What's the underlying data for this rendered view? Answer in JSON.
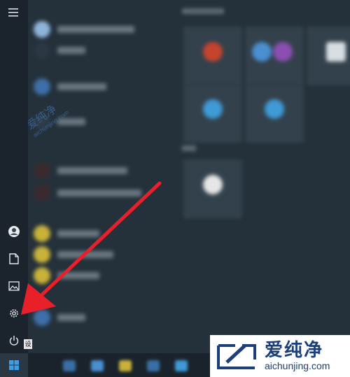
{
  "left_rail": {
    "menu_icon": "hamburger-menu-icon",
    "items": [
      {
        "name": "user-account",
        "icon": "user-avatar-icon"
      },
      {
        "name": "documents",
        "icon": "document-icon"
      },
      {
        "name": "pictures",
        "icon": "picture-icon"
      },
      {
        "name": "settings",
        "icon": "gear-icon"
      },
      {
        "name": "power",
        "icon": "power-icon"
      },
      {
        "name": "start",
        "icon": "windows-logo-icon"
      }
    ],
    "tooltip_partial": "设"
  },
  "annotation": {
    "arrow_color": "#e8202a",
    "arrow_points_to": "settings"
  },
  "watermark": {
    "chinese": "爱纯净",
    "url": "aichunjing.com",
    "color": "#1c3f7a"
  },
  "center_watermark": {
    "chinese": "爱纯净",
    "url": "aichunjing.com"
  }
}
